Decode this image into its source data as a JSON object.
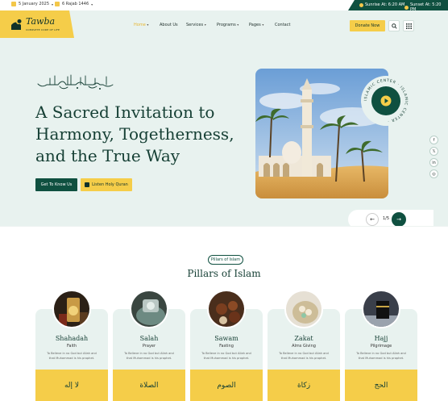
{
  "topbar": {
    "date": "5 January 2025",
    "hijri": "6 Rajab 1446",
    "sunrise": "Sunrise At: 6:20 AM",
    "sunset": "Sunset At: 5:20 PM"
  },
  "brand": {
    "name": "Tawba",
    "tagline": "COMPLETE CODE OF LIFE"
  },
  "nav": [
    {
      "label": "Home",
      "has_menu": true,
      "active": true
    },
    {
      "label": "About Us",
      "has_menu": false
    },
    {
      "label": "Services",
      "has_menu": true
    },
    {
      "label": "Programs",
      "has_menu": true
    },
    {
      "label": "Pages",
      "has_menu": true
    },
    {
      "label": "Contact",
      "has_menu": false
    }
  ],
  "header": {
    "donate_label": "Donate Now"
  },
  "hero": {
    "title": "A Sacred Invitation to Harmony, Togetherness, and the True Way",
    "primary_button": "Get To Know Us",
    "secondary_button": "Listen Holy Quran",
    "badge_text": "ISLAMIC CENTER · ISLAMIC CENTER · ",
    "pager": "1/5"
  },
  "social": [
    "facebook-icon",
    "x-icon",
    "linkedin-icon",
    "instagram-icon"
  ],
  "pillars": {
    "tag": "Pillars of Islam",
    "title": "Pillars of Islam",
    "items": [
      {
        "name": "Shahadah",
        "sub": "Faith",
        "desc": "To Believe in no God but Allah and that Muhammad is his prophet.",
        "arabic": "لا إله"
      },
      {
        "name": "Salah",
        "sub": "Prayer",
        "desc": "To Believe in no God but Allah and that Muhammad is his prophet.",
        "arabic": "الصلاة"
      },
      {
        "name": "Sawam",
        "sub": "Fasting",
        "desc": "To Believe in no God but Allah and that Muhammad is his prophet.",
        "arabic": "الصوم"
      },
      {
        "name": "Zakat",
        "sub": "Alms Giving",
        "desc": "To Believe in no God but Allah and that Muhammad is his prophet.",
        "arabic": "زكاة"
      },
      {
        "name": "Hajj",
        "sub": "Pilgrimage",
        "desc": "To Believe in no God but Allah and that Muhammad is his prophet.",
        "arabic": "الحج"
      }
    ]
  },
  "colors": {
    "primary": "#0f5040",
    "accent": "#f5cd49",
    "mint": "#e8f2ef"
  }
}
